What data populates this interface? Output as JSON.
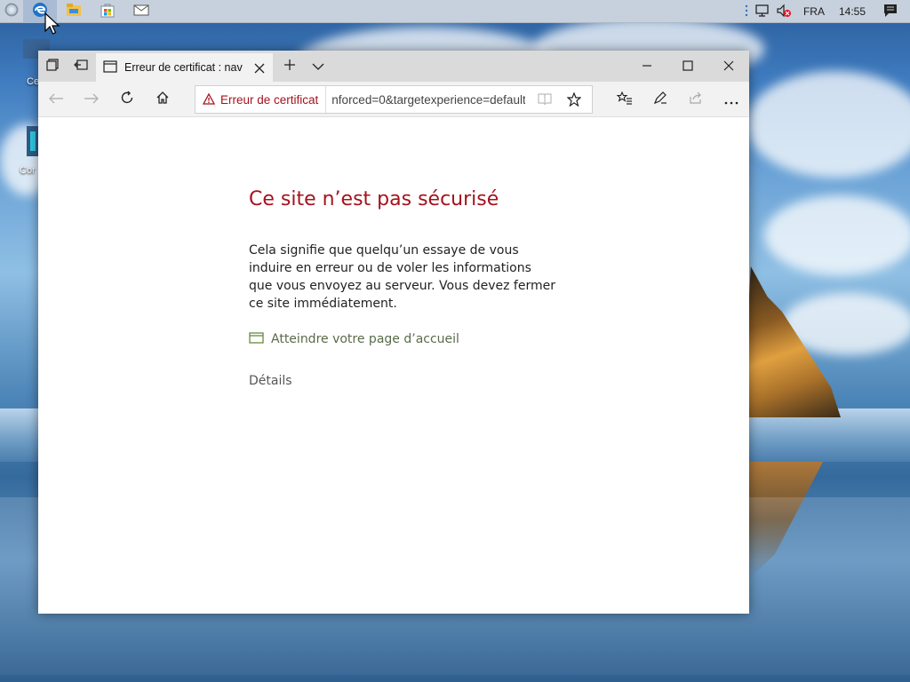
{
  "taskbar": {
    "pinned": [
      {
        "icon": "cortana-icon"
      },
      {
        "icon": "edge-browser-icon",
        "active": true
      },
      {
        "icon": "file-explorer-icon"
      },
      {
        "icon": "store-icon"
      },
      {
        "icon": "mail-icon"
      }
    ],
    "tray": {
      "overflow_icon": "overflow-dots-icon",
      "network_icon": "network-icon",
      "volume_icon": "volume-muted-icon",
      "language": "FRA",
      "time": "14:55",
      "notifications_icon": "action-center-icon"
    }
  },
  "desktop": {
    "icon1_label": "Ce",
    "icon2_label": "Cor"
  },
  "browser": {
    "tab": {
      "title": "Erreur de certificat : nav"
    },
    "address": {
      "warning": "Erreur de certificat",
      "url": "nforced=0&targetexperience=default"
    },
    "page": {
      "title": "Ce site n’est pas sécurisé",
      "body": "Cela signifie que quelqu’un essaye de vous induire en erreur ou de voler les informations que vous envoyez au serveur. Vous devez fermer ce site immédiatement.",
      "home_link": "Atteindre votre page d’accueil",
      "details_link": "Détails"
    }
  },
  "colors": {
    "error_red": "#a4121d",
    "link_green": "#5a6b4a"
  }
}
